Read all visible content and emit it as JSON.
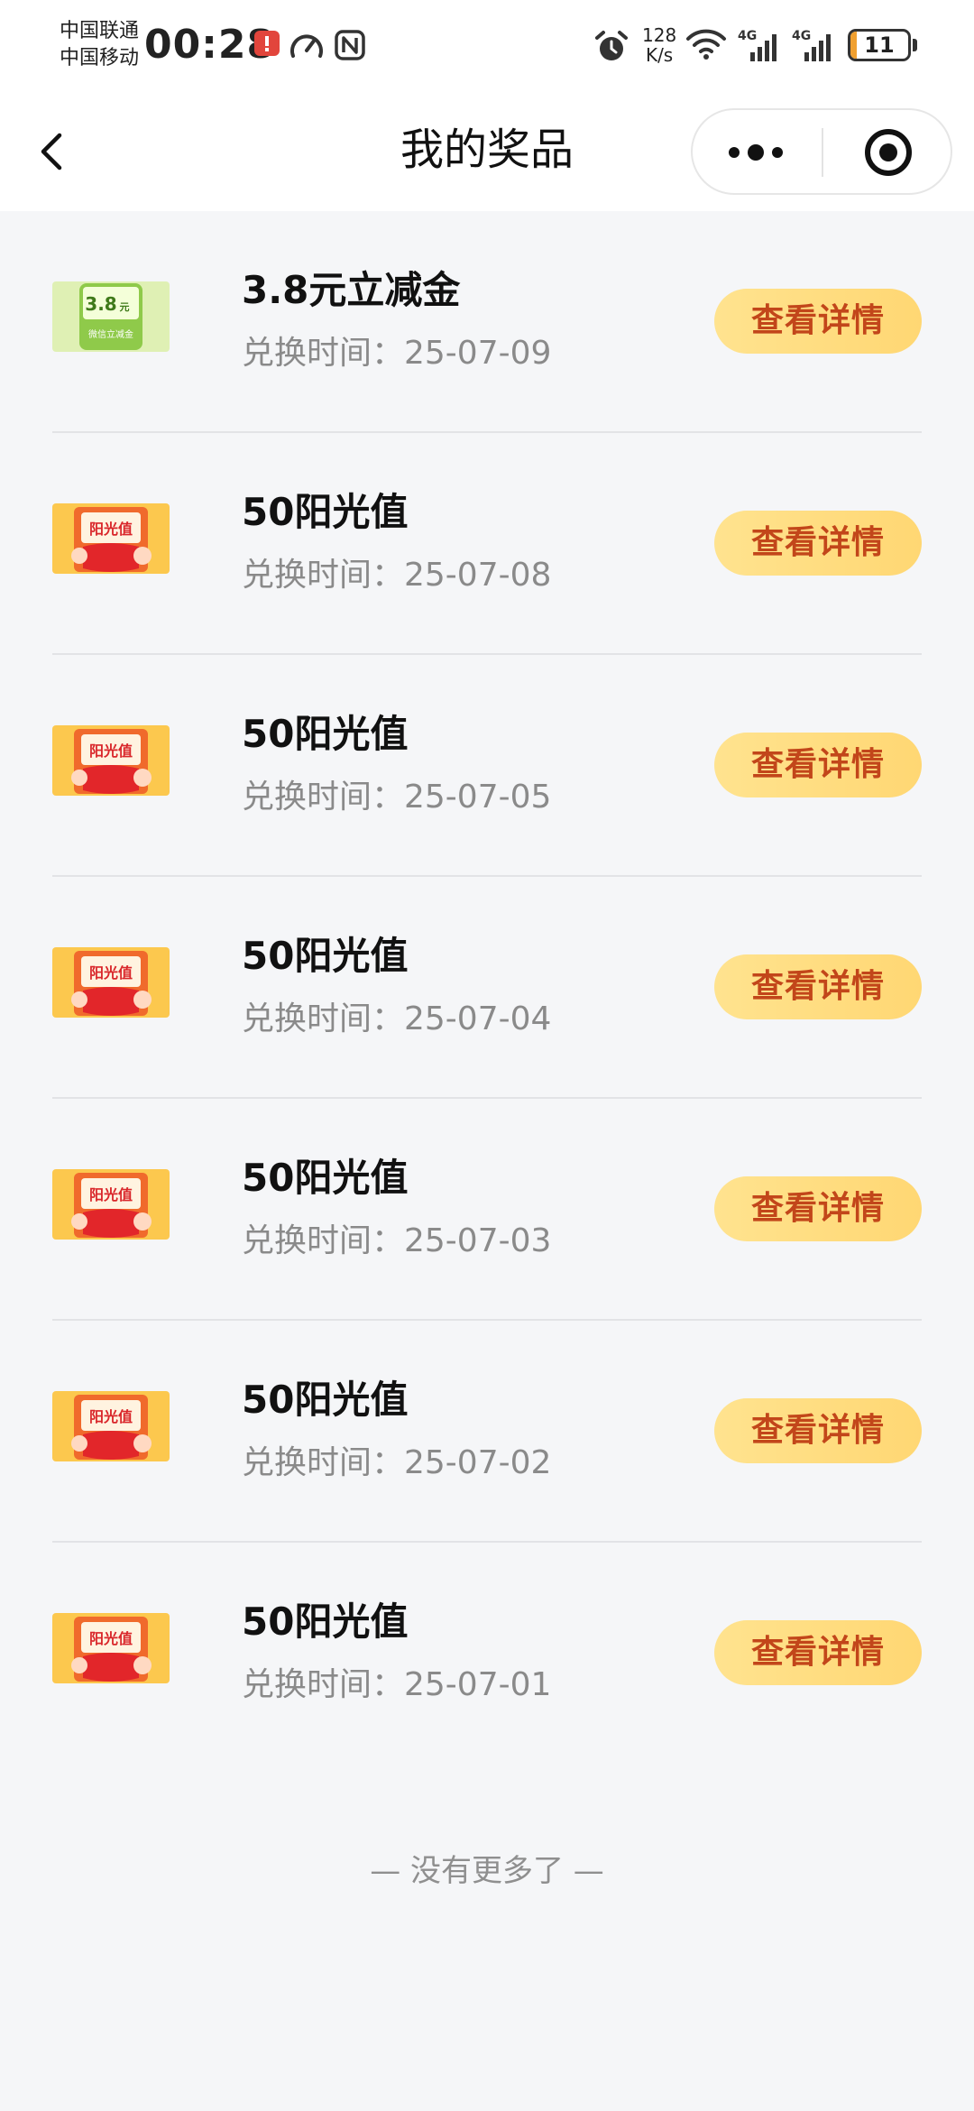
{
  "status_bar": {
    "carriers": [
      "中国联通",
      "中国移动"
    ],
    "time": "00:28",
    "net_speed_value": "128",
    "net_speed_unit": "K/s",
    "signal_labels": [
      "4G",
      "4G"
    ],
    "battery": "11",
    "battery_level": 0.11
  },
  "nav": {
    "title": "我的奖品"
  },
  "prizes": [
    {
      "name": "3.8元立减金",
      "time": "兑换时间：25-07-09",
      "button": "查看详情",
      "thumb": "coupon",
      "thumb_text": "3.8",
      "thumb_unit": "元",
      "thumb_caption": "微信立减金"
    },
    {
      "name": "50阳光值",
      "time": "兑换时间：25-07-08",
      "button": "查看详情",
      "thumb": "sunshine",
      "thumb_text": "阳光值"
    },
    {
      "name": "50阳光值",
      "time": "兑换时间：25-07-05",
      "button": "查看详情",
      "thumb": "sunshine",
      "thumb_text": "阳光值"
    },
    {
      "name": "50阳光值",
      "time": "兑换时间：25-07-04",
      "button": "查看详情",
      "thumb": "sunshine",
      "thumb_text": "阳光值"
    },
    {
      "name": "50阳光值",
      "time": "兑换时间：25-07-03",
      "button": "查看详情",
      "thumb": "sunshine",
      "thumb_text": "阳光值"
    },
    {
      "name": "50阳光值",
      "time": "兑换时间：25-07-02",
      "button": "查看详情",
      "thumb": "sunshine",
      "thumb_text": "阳光值"
    },
    {
      "name": "50阳光值",
      "time": "兑换时间：25-07-01",
      "button": "查看详情",
      "thumb": "sunshine",
      "thumb_text": "阳光值"
    }
  ],
  "footer": {
    "no_more": "— 没有更多了 —"
  },
  "colors": {
    "button_bg": "#ffd773",
    "button_text": "#c2461a",
    "background": "#f5f6f8"
  }
}
